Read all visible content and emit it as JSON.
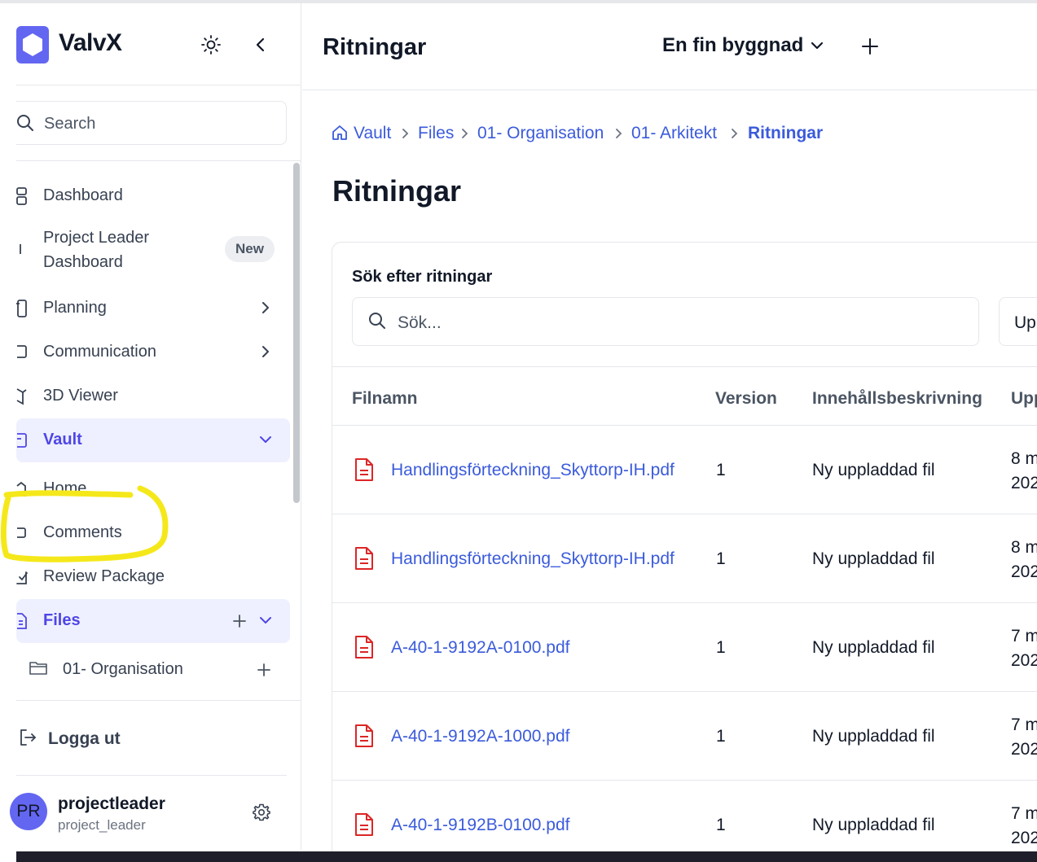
{
  "sidebar": {
    "brand": "ValvX",
    "search_placeholder": "Search",
    "items": [
      {
        "label": "Dashboard"
      },
      {
        "label_line1": "Project Leader",
        "label_line2": "Dashboard",
        "badge": "New"
      },
      {
        "label": "Planning"
      },
      {
        "label": "Communication"
      },
      {
        "label": "3D Viewer"
      },
      {
        "label": "Vault"
      },
      {
        "label": "Home"
      },
      {
        "label": "Comments"
      },
      {
        "label": "Review Package"
      },
      {
        "label": "Files"
      },
      {
        "label": "01- Organisation"
      }
    ],
    "logout": "Logga ut",
    "user": {
      "initials": "PR",
      "name": "projectleader",
      "id": "project_leader"
    }
  },
  "header": {
    "title": "Ritningar",
    "project": "En fin byggnad"
  },
  "breadcrumb": [
    "Vault",
    "Files",
    "01- Organisation",
    "01- Arkitekt",
    "Ritningar"
  ],
  "page": {
    "heading": "Ritningar",
    "search_label": "Sök efter ritningar",
    "search_placeholder": "Sök...",
    "upload_label": "Up"
  },
  "table": {
    "columns": [
      "Filnamn",
      "Version",
      "Innehållsbeskrivning",
      "Upp"
    ],
    "rows": [
      {
        "name": "Handlingsförteckning_Skyttorp-IH.pdf",
        "version": "1",
        "desc": "Ny uppladdad fil",
        "date1": "8 m",
        "date2": "202"
      },
      {
        "name": "Handlingsförteckning_Skyttorp-IH.pdf",
        "version": "1",
        "desc": "Ny uppladdad fil",
        "date1": "8 m",
        "date2": "202"
      },
      {
        "name": "A-40-1-9192A-0100.pdf",
        "version": "1",
        "desc": "Ny uppladdad fil",
        "date1": "7 m",
        "date2": "202"
      },
      {
        "name": "A-40-1-9192A-1000.pdf",
        "version": "1",
        "desc": "Ny uppladdad fil",
        "date1": "7 m",
        "date2": "202"
      },
      {
        "name": "A-40-1-9192B-0100.pdf",
        "version": "1",
        "desc": "Ny uppladdad fil",
        "date1": "7 m",
        "date2": "202"
      }
    ]
  },
  "colors": {
    "accent": "#4f46e5",
    "link": "#3b5bdb",
    "pdf": "#dc2626",
    "highlight": "#f5e81a"
  }
}
